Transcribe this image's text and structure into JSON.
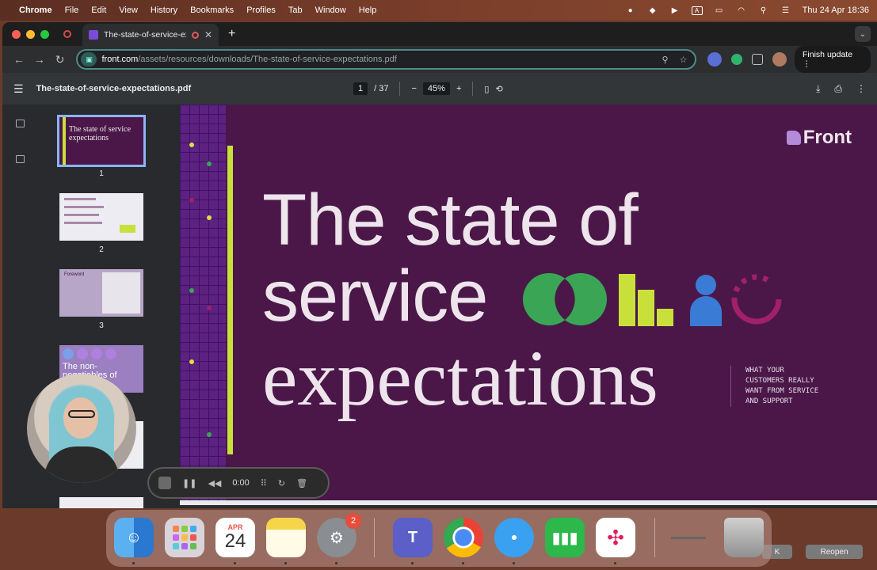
{
  "menubar": {
    "app": "Chrome",
    "items": [
      "File",
      "Edit",
      "View",
      "History",
      "Bookmarks",
      "Profiles",
      "Tab",
      "Window",
      "Help"
    ],
    "datetime": "Thu 24 Apr  18:36"
  },
  "browser": {
    "tab_title": "The-state-of-service-exp",
    "url_host": "front.com",
    "url_path": "/assets/resources/downloads/The-state-of-service-expectations.pdf",
    "finish_update_label": "Finish update"
  },
  "pdf": {
    "filename": "The-state-of-service-expectations.pdf",
    "current_page": "1",
    "total_pages": "/ 37",
    "zoom": "45%",
    "thumbnails": [
      {
        "num": "1"
      },
      {
        "num": "2"
      },
      {
        "num": "3"
      }
    ],
    "thumb1_text": "The state of service expectations",
    "thumb3_label": "Foreword",
    "thumb4_text": "The non-negotiables of service"
  },
  "slide": {
    "brand": "Front",
    "line1": "The state of",
    "line2": "service",
    "line3": "expectations",
    "tagline": [
      "WHAT YOUR",
      "CUSTOMERS REALLY",
      "WANT FROM SERVICE",
      "AND SUPPORT"
    ],
    "colors": {
      "background": "#4a1748",
      "yellow": "#c9e03b",
      "green": "#3aa655",
      "blue": "#3a7bd5",
      "magenta": "#a0206a"
    }
  },
  "recorder": {
    "time": "0:00"
  },
  "dock": {
    "calendar_month": "APR",
    "calendar_day": "24",
    "settings_badge": "2"
  },
  "background_buttons": {
    "left": "K",
    "right": "Reopen"
  }
}
